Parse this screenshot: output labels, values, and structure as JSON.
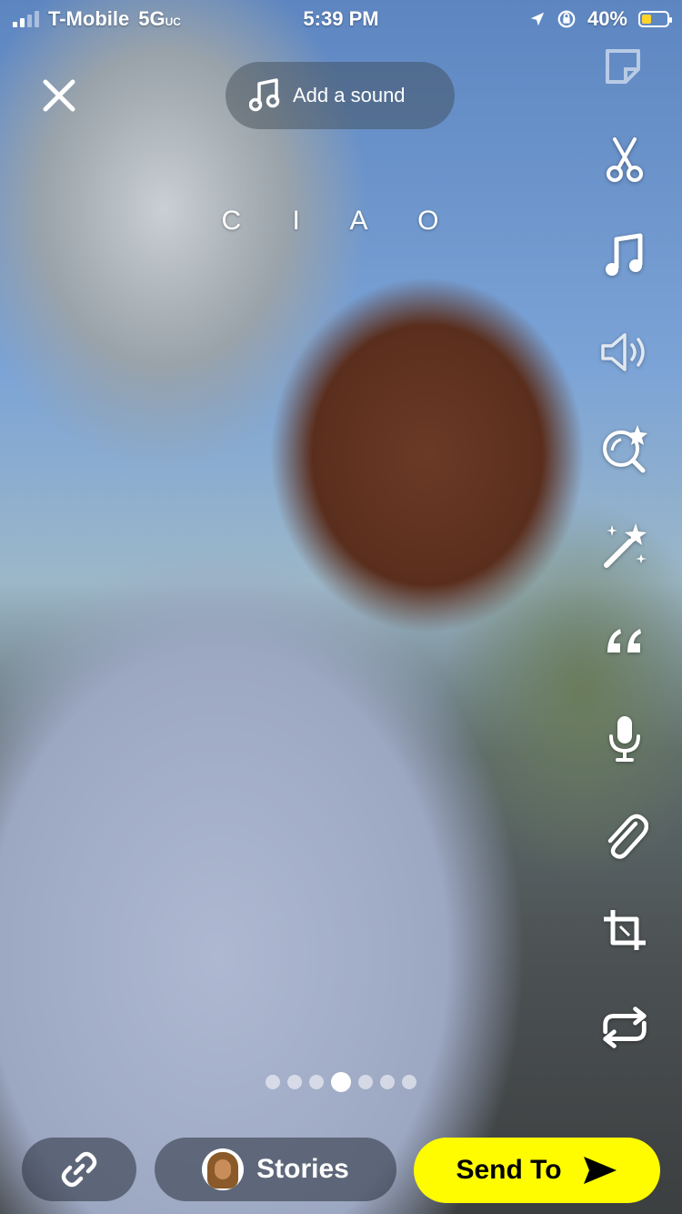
{
  "status_bar": {
    "carrier": "T-Mobile",
    "network": "5G",
    "network_suffix": "UC",
    "time": "5:39 PM",
    "battery": "40%",
    "battery_level": 0.4
  },
  "top": {
    "sound_label": "Add a sound",
    "caption_text": "C I A O"
  },
  "toolbar": {
    "icons": [
      "scissors-icon",
      "music-note-icon",
      "speaker-icon",
      "lens-explorer-icon",
      "magic-wand-icon",
      "quote-icon",
      "microphone-icon",
      "paperclip-icon",
      "crop-icon",
      "loop-icon"
    ]
  },
  "pager": {
    "count": 7,
    "active_index": 3
  },
  "bottom": {
    "stories_label": "Stories",
    "send_label": "Send To"
  },
  "colors": {
    "send_button": "#fffc00",
    "battery_fill": "#ffd42a"
  }
}
